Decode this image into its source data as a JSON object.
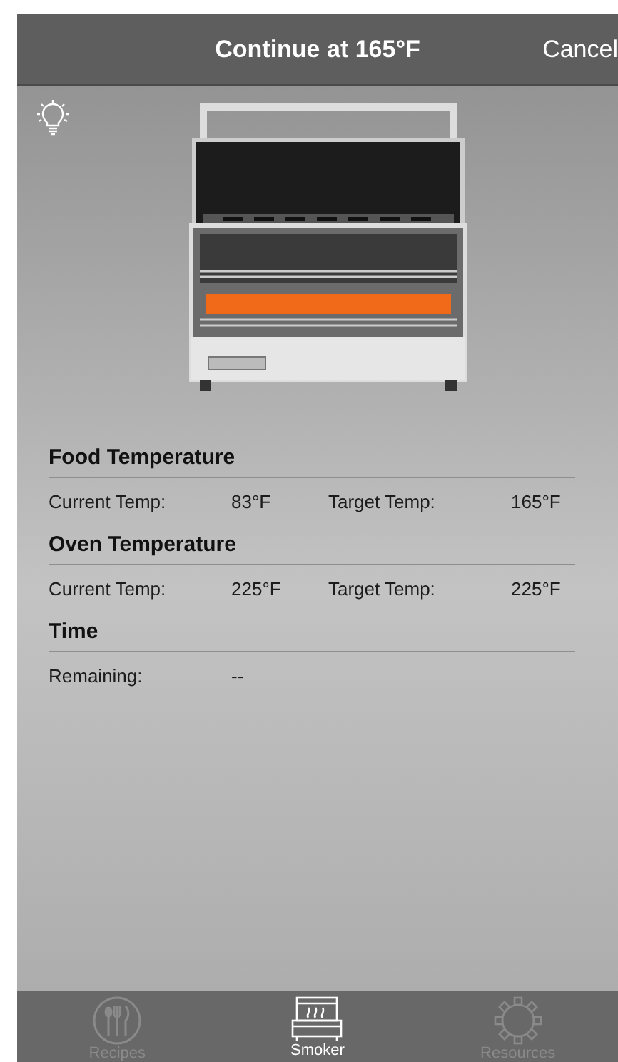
{
  "nav_bar": {
    "title": "Continue at 165°F",
    "action": "Cancel"
  },
  "sections": [
    {
      "title": "Food Temperature",
      "rows": [
        {
          "label": "Current Temp:",
          "value": "83°F",
          "label_2": "Target Temp:",
          "value_2": "165°F"
        }
      ]
    },
    {
      "title": "Oven Temperature",
      "rows": [
        {
          "label": "Current Temp:",
          "value": "225°F",
          "label_2": "Target Temp:",
          "value_2": "225°F"
        }
      ]
    },
    {
      "title": "Time",
      "rows": [
        {
          "label": "Remaining:",
          "value": "--"
        }
      ]
    }
  ],
  "tab_bar": [
    {
      "kind": "recipes",
      "label": "Recipes",
      "selected": false
    },
    {
      "kind": "smoker",
      "label": "Smoker",
      "selected": true
    },
    {
      "kind": "resources",
      "label": "Resources",
      "selected": false
    }
  ]
}
